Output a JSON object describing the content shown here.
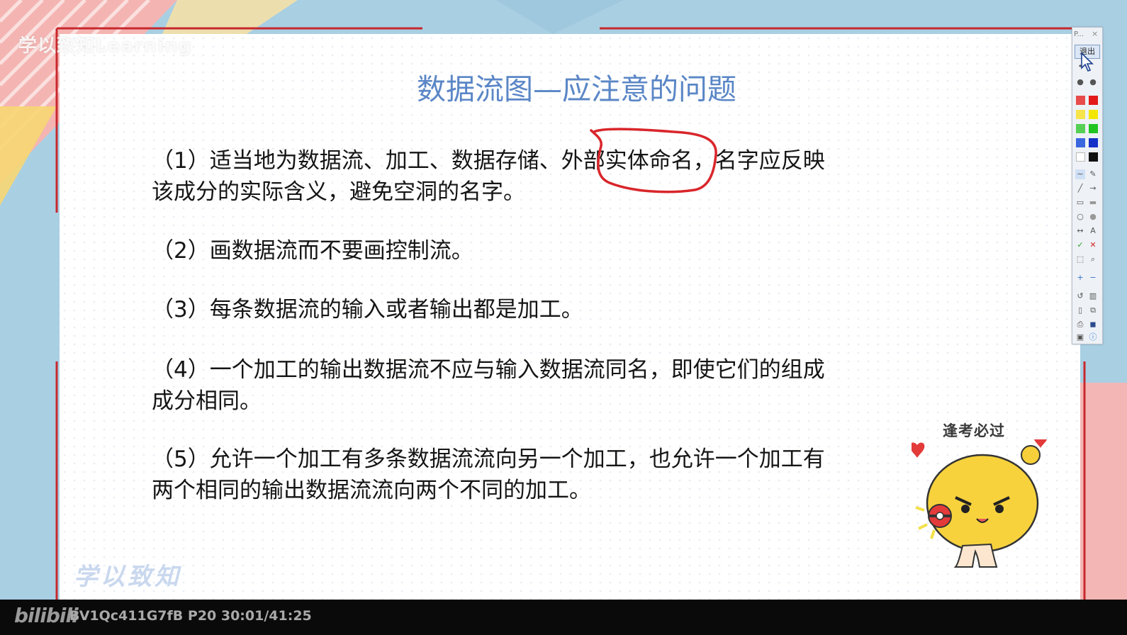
{
  "watermark": "学以致知Learning",
  "slide": {
    "title": "数据流图—应注意的问题",
    "items": [
      {
        "line1": "（1）适当地为数据流、加工、数据存储、外部实体命名，名字应反映",
        "line2": "该成分的实际含义，避免空洞的名字。"
      },
      {
        "line1": "（2）画数据流而不要画控制流。",
        "line2": ""
      },
      {
        "line1": "（3）每条数据流的输入或者输出都是加工。",
        "line2": ""
      },
      {
        "line1": "（4）一个加工的输出数据流不应与输入数据流同名，即使它们的组成",
        "line2": "成分相同。"
      },
      {
        "line1": "（5）允许一个加工有多条数据流流向另一个加工，也允许一个加工有",
        "line2": "两个相同的输出数据流流向两个不同的加工。"
      }
    ],
    "signature": "学以致知",
    "sticker_text": "逢考必过"
  },
  "player": {
    "logo": "bilibili",
    "video_info": "BV1Qc411G7fB P20 30:01/41:25"
  },
  "toolbar": {
    "title": "P...",
    "close": "×",
    "exit_label": "退出",
    "colors": [
      "#e84b4b",
      "#e31919",
      "#f6e44a",
      "#f3e600",
      "#55d055",
      "#21c521",
      "#3a66e0",
      "#1531c8",
      "#ffffff",
      "#111111"
    ],
    "icons": [
      "pen-icon",
      "highlighter-icon",
      "line-icon",
      "arrow-icon",
      "rect-icon",
      "rect-fill-icon",
      "ellipse-icon",
      "ellipse-fill-icon",
      "double-arrow-icon",
      "text-icon",
      "check-icon",
      "cross-icon",
      "select-icon",
      "zoom-icon",
      "plus-icon",
      "minus-icon",
      "undo-icon",
      "trash-icon",
      "page-icon",
      "copy-icon",
      "print-icon",
      "save-icon",
      "screen-icon",
      "info-icon"
    ],
    "text_icon_label": "A"
  },
  "colors": {
    "title": "#5a86c6",
    "annotation": "#d9262b",
    "accent_red": "#c8282d"
  }
}
